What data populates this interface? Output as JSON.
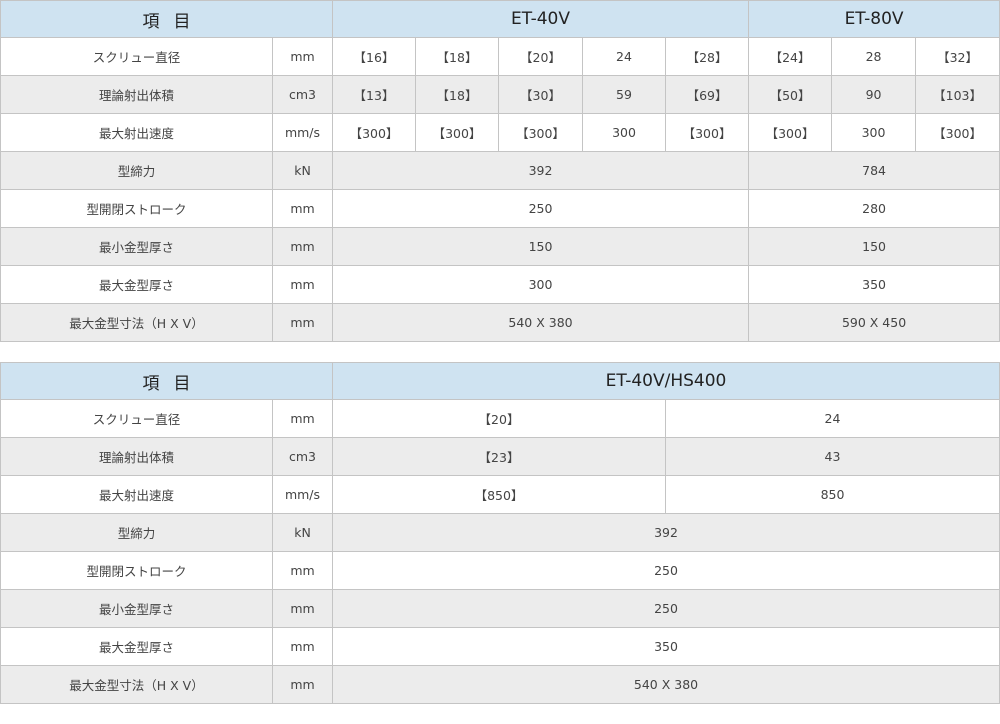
{
  "table1": {
    "header": {
      "item": "項目",
      "model_a": "ET-40V",
      "model_b": "ET-80V"
    },
    "rows": [
      {
        "label": "スクリュー直径",
        "unit": "mm",
        "a": [
          "【16】",
          "【18】",
          "【20】",
          "24",
          "【28】"
        ],
        "b": [
          "【24】",
          "28",
          "【32】"
        ]
      },
      {
        "label": "理論射出体積",
        "unit": "cm3",
        "a": [
          "【13】",
          "【18】",
          "【30】",
          "59",
          "【69】"
        ],
        "b": [
          "【50】",
          "90",
          "【103】"
        ]
      },
      {
        "label": "最大射出速度",
        "unit": "mm/s",
        "a": [
          "【300】",
          "【300】",
          "【300】",
          "300",
          "【300】"
        ],
        "b": [
          "【300】",
          "300",
          "【300】"
        ]
      },
      {
        "label": "型締力",
        "unit": "kN",
        "a": "392",
        "b": "784"
      },
      {
        "label": "型開閉ストローク",
        "unit": "mm",
        "a": "250",
        "b": "280"
      },
      {
        "label": "最小金型厚さ",
        "unit": "mm",
        "a": "150",
        "b": "150"
      },
      {
        "label": "最大金型厚さ",
        "unit": "mm",
        "a": "300",
        "b": "350"
      },
      {
        "label": "最大金型寸法（H X V）",
        "unit": "mm",
        "a": "540 X 380",
        "b": "590 X 450"
      }
    ]
  },
  "table2": {
    "header": {
      "item": "項目",
      "model": "ET-40V/HS400"
    },
    "rows": [
      {
        "label": "スクリュー直径",
        "unit": "mm",
        "v": [
          "【20】",
          "24"
        ]
      },
      {
        "label": "理論射出体積",
        "unit": "cm3",
        "v": [
          "【23】",
          "43"
        ]
      },
      {
        "label": "最大射出速度",
        "unit": "mm/s",
        "v": [
          "【850】",
          "850"
        ]
      },
      {
        "label": "型締力",
        "unit": "kN",
        "v": "392"
      },
      {
        "label": "型開閉ストローク",
        "unit": "mm",
        "v": "250"
      },
      {
        "label": "最小金型厚さ",
        "unit": "mm",
        "v": "250"
      },
      {
        "label": "最大金型厚さ",
        "unit": "mm",
        "v": "350"
      },
      {
        "label": "最大金型寸法（H X V）",
        "unit": "mm",
        "v": "540 X 380"
      }
    ]
  }
}
